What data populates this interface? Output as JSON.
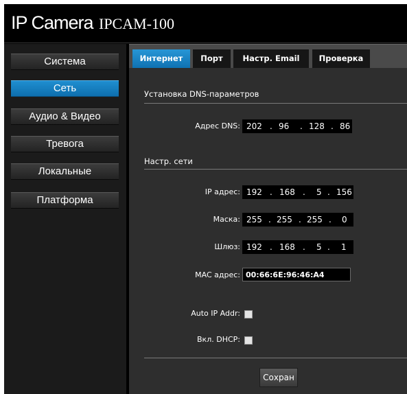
{
  "header": {
    "brand": "IP Camera",
    "model": "IPCAM-100"
  },
  "sidebar": {
    "items": [
      {
        "label": "Система",
        "active": false
      },
      {
        "label": "Сеть",
        "active": true
      },
      {
        "label": "Аудио & Видео",
        "active": false
      },
      {
        "label": "Тревога",
        "active": false
      },
      {
        "label": "Локальные",
        "active": false
      },
      {
        "label": "Платформа",
        "active": false
      }
    ]
  },
  "tabs": [
    {
      "label": "Интернет",
      "active": true
    },
    {
      "label": "Порт",
      "active": false
    },
    {
      "label": "Настр. Email",
      "active": false
    },
    {
      "label": "Проверка",
      "active": false
    }
  ],
  "dns_section": {
    "title": "Установка DNS-параметров",
    "dns_label": "Адрес DNS:",
    "dns_octets": [
      "202",
      "96",
      "128",
      "86"
    ]
  },
  "network_section": {
    "title": "Настр. сети",
    "ip_label": "IP адрес:",
    "ip_octets": [
      "192",
      "168",
      "5",
      "156"
    ],
    "mask_label": "Маска:",
    "mask_octets": [
      "255",
      "255",
      "255",
      "0"
    ],
    "gateway_label": "Шлюз:",
    "gateway_octets": [
      "192",
      "168",
      "5",
      "1"
    ],
    "mac_label": "MAC адрес:",
    "mac_value": "00:66:6E:96:46:A4",
    "auto_ip_label": "Auto IP Addr:",
    "auto_ip_checked": false,
    "dhcp_label": "Вкл. DHCP:",
    "dhcp_checked": false
  },
  "actions": {
    "save_label": "Сохран"
  },
  "colors": {
    "accent": "#1483c4",
    "background": "#000000",
    "panel": "#2e2e2e"
  }
}
